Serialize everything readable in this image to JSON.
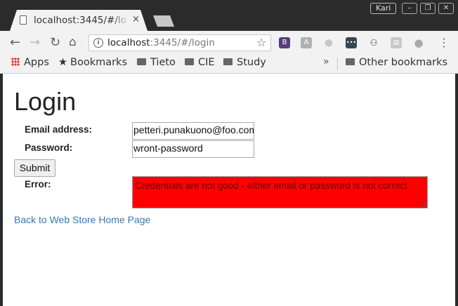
{
  "browser": {
    "tab_title": "localhost:3445/#/lo",
    "tab_close": "×",
    "user_name": "Kari",
    "window_controls": [
      "–",
      "❐",
      "✕"
    ],
    "url_host": "localhost",
    "url_path": ":3445/#/login",
    "nav_icons": [
      "back-arrow-icon",
      "forward-arrow-icon",
      "reload-icon",
      "home-icon"
    ],
    "extensions": [
      {
        "name": "bootstrap-extension-icon",
        "glyph": "B",
        "color": "#563d7c"
      },
      {
        "name": "angular-extension-icon",
        "glyph": "A",
        "color": "#b0b0b0"
      },
      {
        "name": "lightbulb-extension-icon",
        "glyph": "●",
        "color": "#c8c8c8"
      },
      {
        "name": "dots-extension-icon",
        "glyph": "•••",
        "color": "#37474f"
      },
      {
        "name": "person-extension-icon",
        "glyph": "👤",
        "color": "#f2f2f2"
      },
      {
        "name": "chat-extension-icon",
        "glyph": "▤",
        "color": "#c8c8c8"
      },
      {
        "name": "balloon-extension-icon",
        "glyph": "●",
        "color": "#a9a9a9"
      }
    ]
  },
  "bookmarks": {
    "apps": "Apps",
    "bookmarks": "Bookmarks",
    "tieto": "Tieto",
    "cie": "CIE",
    "study": "Study",
    "overflow": "»",
    "other": "Other bookmarks"
  },
  "page": {
    "title": "Login",
    "email_label": "Email address:",
    "email_value": "petteri.punakuono@foo.com",
    "password_label": "Password:",
    "password_value": "wront-password",
    "submit_label": "Submit",
    "error_label": "Error:",
    "error_text": "Credentials are not good - either email or password is not correct",
    "error_color": "#ff0000",
    "back_link": "Back to Web Store Home Page",
    "link_color": "#337ab7"
  }
}
